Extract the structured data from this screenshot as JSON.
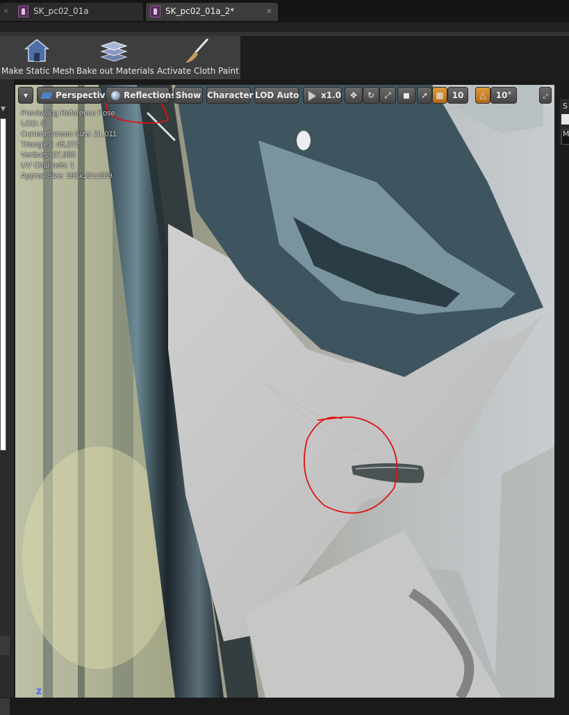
{
  "tabs": [
    {
      "label": "SK_pc02_01a",
      "close": "×"
    },
    {
      "label": "SK_pc02_01a_2*",
      "close": "×"
    }
  ],
  "toolbar": {
    "make_static_mesh": "Make Static Mesh",
    "bake_out_materials": "Bake out Materials",
    "activate_cloth_paint": "Activate Cloth Paint"
  },
  "viewport_toolbar": {
    "perspective": "Perspective",
    "reflections": "Reflections",
    "show": "Show",
    "character": "Character",
    "lod": "LOD Auto",
    "play_speed": "x1.0",
    "grid_snap": "10",
    "rotation_snap": "10°"
  },
  "stats": {
    "line1": "Previewing Reference Pose",
    "line2": "LOD: 0",
    "line3": "Current Screen Size: 21.011",
    "line4": "Triangles: 45,272",
    "line5": "Vertices: 27,950",
    "line6": "UV Channels: 1",
    "line7": "Approx Size: 295x151x289"
  },
  "axis_label": "Z",
  "right_panel": {
    "t1": "S",
    "t2": "M"
  },
  "colors": {
    "annotation": "#e01010",
    "accent": "#e59a2e"
  }
}
